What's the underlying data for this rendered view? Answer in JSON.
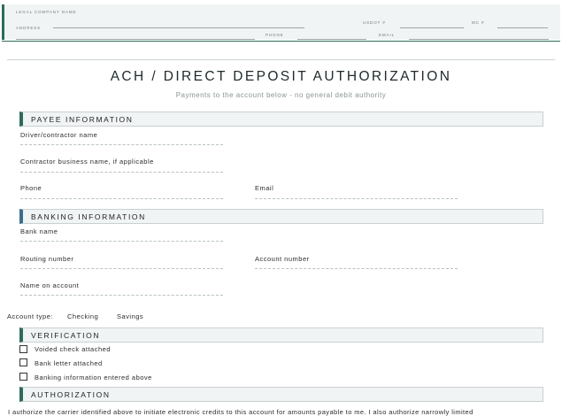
{
  "letterhead": {
    "legal_company_name": "LEGAL COMPANY NAME",
    "address": "ADDRESS",
    "usdot": "USDOT #",
    "mc": "MC #",
    "phone": "PHONE",
    "email": "EMAIL"
  },
  "title": "ACH / DIRECT DEPOSIT AUTHORIZATION",
  "subtitle": "Payments to the account below - no general debit authority",
  "payee": {
    "header": "PAYEE INFORMATION",
    "driver_label": "Driver/contractor name",
    "business_label": "Contractor business name, if applicable",
    "phone_label": "Phone",
    "email_label": "Email"
  },
  "banking": {
    "header": "BANKING INFORMATION",
    "bank_name_label": "Bank name",
    "routing_label": "Routing number",
    "account_number_label": "Account number",
    "name_on_account_label": "Name on account"
  },
  "account_type": {
    "label": "Account type:",
    "option_checking": "Checking",
    "option_savings": "Savings"
  },
  "verification": {
    "header": "VERIFICATION",
    "items": [
      "Voided check attached",
      "Bank letter attached",
      "Banking information entered above"
    ]
  },
  "authorization": {
    "header": "AUTHORIZATION",
    "text": "I authorize the carrier identified above to initiate electronic credits to this account for amounts payable to me. I also authorize narrowly limited"
  },
  "colors": {
    "accent_green": "#2f6b5c",
    "accent_blue": "#3b6e8a"
  }
}
